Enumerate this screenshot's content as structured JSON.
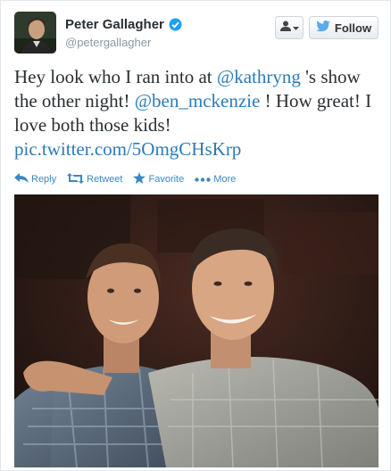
{
  "user": {
    "name": "Peter Gallagher",
    "handle": "@petergallagher"
  },
  "header": {
    "follow_label": "Follow"
  },
  "tweet": {
    "text1": "Hey look who I ran into at ",
    "mention1": "@kathryng",
    "text2": " 's show the other night! ",
    "mention2": "@ben_mckenzie",
    "text3": " ! How great! I love both those kids! ",
    "link": "pic.twitter.com/5OmgCHsKrp"
  },
  "actions": {
    "reply": "Reply",
    "retweet": "Retweet",
    "favorite": "Favorite",
    "more": "More"
  },
  "colors": {
    "link": "#2b7bb9",
    "action": "#3b88c3",
    "verified": "#1da1f2",
    "text": "#292f33",
    "muted": "#8899a6"
  }
}
